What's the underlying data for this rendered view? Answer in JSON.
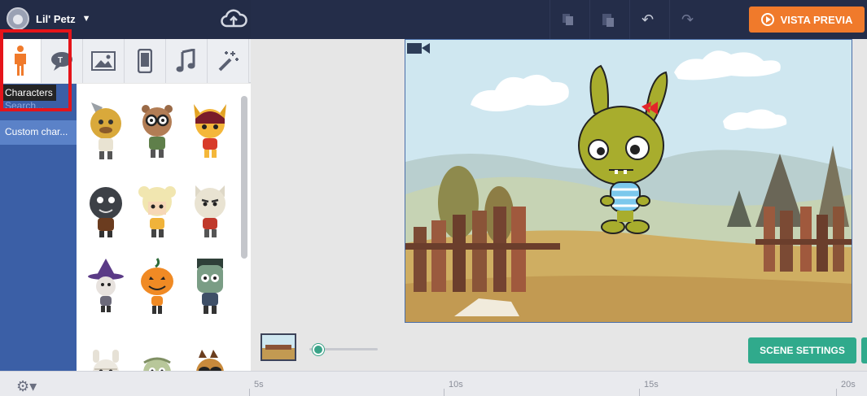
{
  "topbar": {
    "project_name": "Lil' Petz",
    "preview_label": "VISTA PREVIA",
    "icons": [
      "copy-icon",
      "paste-icon",
      "undo-icon",
      "redo-icon",
      "cloud-upload-icon"
    ]
  },
  "category_tabs": [
    {
      "name": "characters",
      "icon": "person-icon",
      "active": true
    },
    {
      "name": "text",
      "icon": "speech-bubble-icon",
      "active": false
    },
    {
      "name": "props",
      "icon": "image-icon",
      "active": false
    },
    {
      "name": "devices",
      "icon": "phone-icon",
      "active": false
    },
    {
      "name": "music",
      "icon": "music-note-icon",
      "active": false
    },
    {
      "name": "effects",
      "icon": "magic-wand-icon",
      "active": false
    }
  ],
  "tooltip": "Characters",
  "sidebar": {
    "search_hint": "Search...",
    "items": [
      {
        "label": "Custom char..."
      }
    ]
  },
  "characters": [
    {
      "label": "hatchet-bear"
    },
    {
      "label": "nerd-beaver"
    },
    {
      "label": "fox-girl"
    },
    {
      "label": "dark-blob"
    },
    {
      "label": "blonde-girl"
    },
    {
      "label": "grumpy-cat"
    },
    {
      "label": "witch"
    },
    {
      "label": "pumpkin"
    },
    {
      "label": "frankenstein"
    },
    {
      "label": "mummy-bunny"
    },
    {
      "label": "zombie"
    },
    {
      "label": "sunglasses-bear"
    }
  ],
  "scene": {
    "scene_settings_label": "SCENE SETTINGS"
  },
  "timeline": {
    "ticks": [
      "5s",
      "10s",
      "15s",
      "20s"
    ]
  },
  "colors": {
    "topbar": "#232c47",
    "accent_orange": "#f07a2b",
    "accent_green": "#30aa8c",
    "sidebar_blue": "#3b5fa6"
  }
}
